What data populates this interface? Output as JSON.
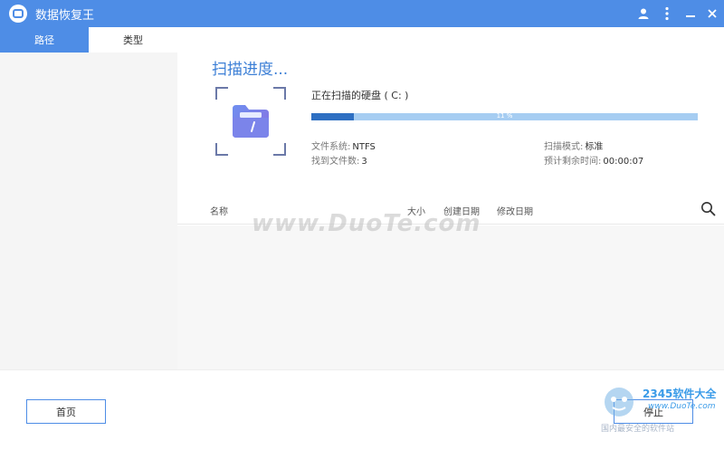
{
  "window": {
    "title": "数据恢复王"
  },
  "tabs": [
    {
      "label": "路径",
      "active": true
    },
    {
      "label": "类型",
      "active": false
    }
  ],
  "scan": {
    "title": "扫描进度...",
    "disk_label": "正在扫描的硬盘 ( C: )",
    "progress_percent": 11,
    "progress_text": "11 %",
    "file_system_label": "文件系统:",
    "file_system_value": "NTFS",
    "files_found_label": "找到文件数:",
    "files_found_value": "3",
    "scan_mode_label": "扫描模式:",
    "scan_mode_value": "标准",
    "time_left_label": "预计剩余时间:",
    "time_left_value": "00:00:07"
  },
  "columns": {
    "name": "名称",
    "size": "大小",
    "created": "创建日期",
    "modified": "修改日期"
  },
  "footer": {
    "home_label": "首页",
    "stop_label": "停止"
  },
  "watermark": "www.DuoTe.com",
  "badge": {
    "title": "2345软件大全",
    "url": "www.DuoTe.com",
    "slogan": "国内最安全的软件站"
  },
  "colors": {
    "accent": "#4e8de6",
    "progress_fill": "#2e6fc2",
    "progress_track": "#a6cdf2",
    "title_blue": "#3c7fd6"
  },
  "icons": {
    "app": "app-logo-icon",
    "user": "user-icon",
    "more": "more-vertical-icon",
    "minimize": "minimize-icon",
    "close": "close-icon",
    "folder": "folder-icon",
    "search": "search-icon"
  }
}
